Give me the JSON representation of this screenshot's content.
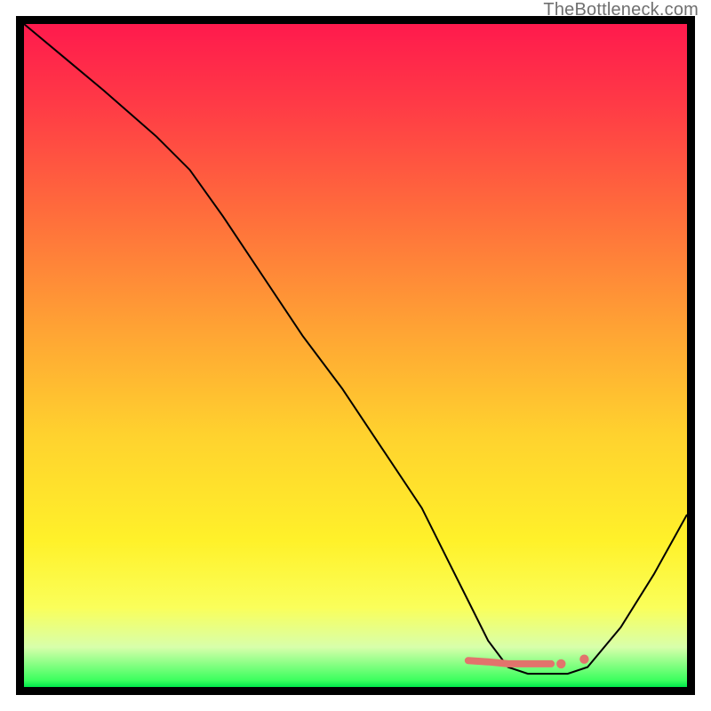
{
  "branding": "TheBottleneck.com",
  "colors": {
    "dot_stroke": "#e2736c",
    "curve_stroke": "#000000"
  },
  "chart_data": {
    "type": "line",
    "title": "",
    "xlabel": "",
    "ylabel": "",
    "xlim": [
      0,
      100
    ],
    "ylim": [
      0,
      100
    ],
    "grid": false,
    "legend": false,
    "series": [
      {
        "name": "bottleneck-curve",
        "x": [
          0,
          6,
          12,
          20,
          25,
          30,
          36,
          42,
          48,
          54,
          60,
          64,
          67,
          70,
          73,
          76,
          79,
          82,
          85,
          90,
          95,
          100
        ],
        "values": [
          100,
          95,
          90,
          83,
          78,
          71,
          62,
          53,
          45,
          36,
          27,
          19,
          13,
          7,
          3,
          2,
          2,
          2,
          3,
          9,
          17,
          26
        ]
      }
    ],
    "highlight_segment": {
      "name": "coral-dots",
      "x": [
        67,
        70,
        73,
        74.5,
        76,
        79.5,
        81,
        84.5
      ],
      "values": [
        4,
        3.8,
        3.5,
        3.5,
        3.5,
        3.5,
        3.5,
        4.2
      ]
    },
    "gradient_stops": [
      {
        "pos": 0,
        "color": "#ff1a4d"
      },
      {
        "pos": 28,
        "color": "#ff6b3c"
      },
      {
        "pos": 62,
        "color": "#ffd22e"
      },
      {
        "pos": 88,
        "color": "#faff5a"
      },
      {
        "pos": 99,
        "color": "#3bff5e"
      },
      {
        "pos": 100,
        "color": "#00e84a"
      }
    ]
  }
}
